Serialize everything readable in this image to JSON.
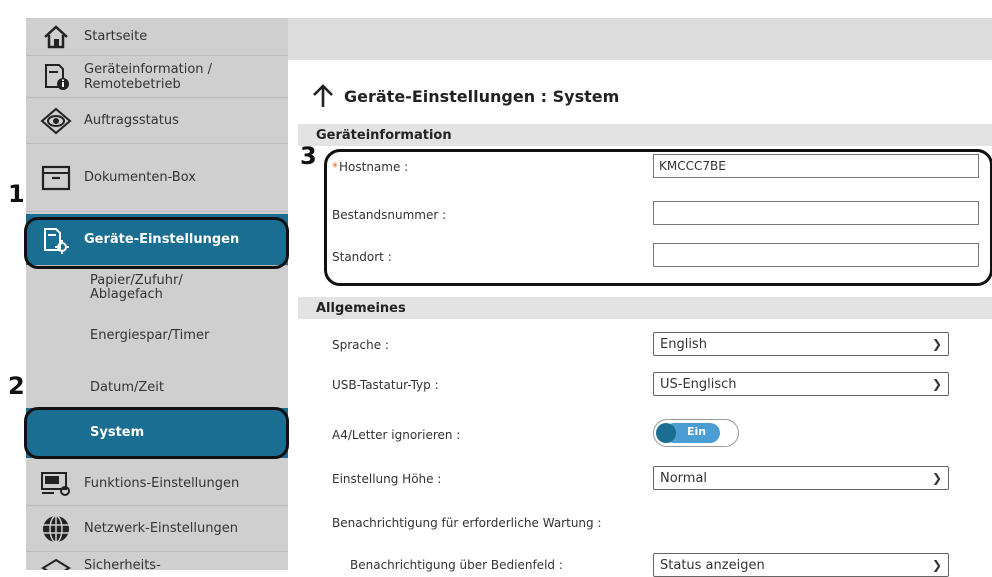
{
  "sidebar": {
    "items": [
      {
        "label": "Startseite"
      },
      {
        "label": "Geräteinformation / Remotebetrieb"
      },
      {
        "label": "Auftragsstatus"
      },
      {
        "label": "Dokumenten-Box"
      },
      {
        "label": "Geräte-Einstellungen"
      },
      {
        "label": "Funktions-Einstellungen"
      },
      {
        "label": "Netzwerk-Einstellungen"
      },
      {
        "label": "Sicherheits-"
      }
    ],
    "subitems": [
      {
        "label": "Papier/Zufuhr/ Ablagefach"
      },
      {
        "label": "Energiespar/Timer"
      },
      {
        "label": "Datum/Zeit"
      },
      {
        "label": "System"
      }
    ]
  },
  "page": {
    "title": "Geräte-Einstellungen : System"
  },
  "sections": {
    "device_info": {
      "title": "Geräteinformation",
      "hostname_label": "Hostname :",
      "hostname_value": "KMCCC7BE",
      "asset_label": "Bestandsnummer :",
      "asset_value": "",
      "location_label": "Standort :",
      "location_value": ""
    },
    "general": {
      "title": "Allgemeines",
      "language_label": "Sprache :",
      "language_value": "English",
      "usb_label": "USB-Tastatur-Typ :",
      "usb_value": "US-Englisch",
      "a4_label": "A4/Letter ignorieren :",
      "a4_value": "Ein",
      "altitude_label": "Einstellung Höhe :",
      "altitude_value": "Normal",
      "maint_label": "Benachrichtigung für erforderliche Wartung :",
      "panel_label": "Benachrichtigung über Bedienfeld :",
      "panel_value": "Status anzeigen"
    }
  },
  "callouts": {
    "one": "1",
    "two": "2",
    "three": "3"
  },
  "colors": {
    "accent": "#1a6e91",
    "sidebar_bg": "#cfcfcf",
    "section_bg": "#e3e3e3",
    "required": "#e2711d"
  }
}
